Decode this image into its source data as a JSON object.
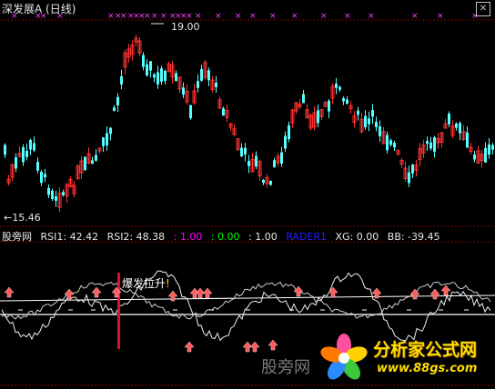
{
  "header": {
    "stock_name": "深发展A",
    "period": "(日线)",
    "close_icon": "close-x-icon"
  },
  "price_panel": {
    "high_label": "19.00",
    "low_label": "←15.46"
  },
  "indicator_bar": {
    "name": "股旁网",
    "rsi1": "RSI1: 42.42",
    "rsi2": "RSI2: 48.38",
    "v1": ": 1.00",
    "v2": ": 0.00",
    "v3": ": 1.00",
    "rader": "RADER1",
    "xg": "XG: 0.00",
    "bb": "BB: -39.45"
  },
  "annotation": "爆发拉升",
  "watermark": "股旁网",
  "logo": {
    "title": "分析家公式网",
    "url": "www.88gs.com"
  },
  "colors": {
    "up": "#ff3232",
    "down": "#54ffff",
    "marker": "#ff40ff",
    "white_line": "#ffffff",
    "arrow": "#ff5a5a",
    "rader": "#0000ff",
    "green": "#00ff00",
    "magenta": "#ff00ff"
  }
}
